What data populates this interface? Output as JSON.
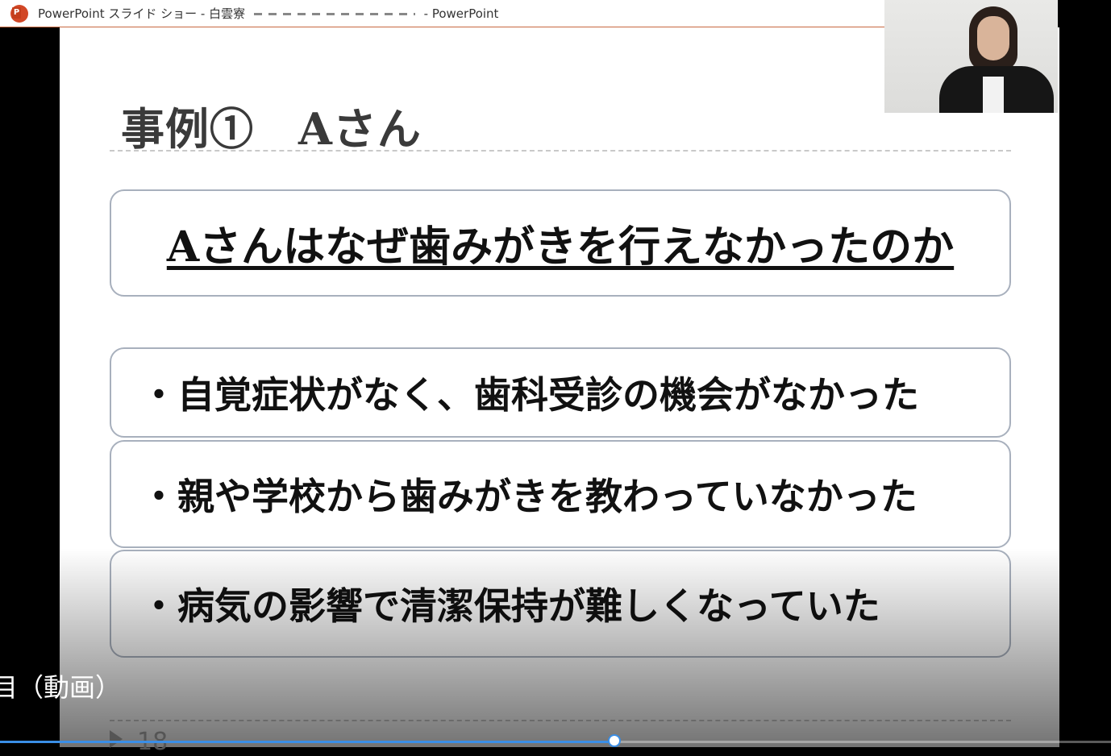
{
  "window": {
    "app_icon": "powerpoint-icon",
    "title_prefix": "PowerPoint スライド ショー  -  白雲寮",
    "title_suffix": "- PowerPoint"
  },
  "slide": {
    "title": "事例①　Aさん",
    "question": "Aさんはなぜ歯みがきを行えなかったのか",
    "bullets": [
      "・自覚症状がなく、歯科受診の機会がなかった",
      "・親や学校から歯みがきを教わっていなかった",
      "・病気の影響で清潔保持が難しくなっていた"
    ],
    "slide_number": "18"
  },
  "video": {
    "caption": "目（動画）",
    "progress": 0.553,
    "progress_color": "#3a8ee6"
  },
  "webcam": {
    "label": "presenter-video"
  }
}
